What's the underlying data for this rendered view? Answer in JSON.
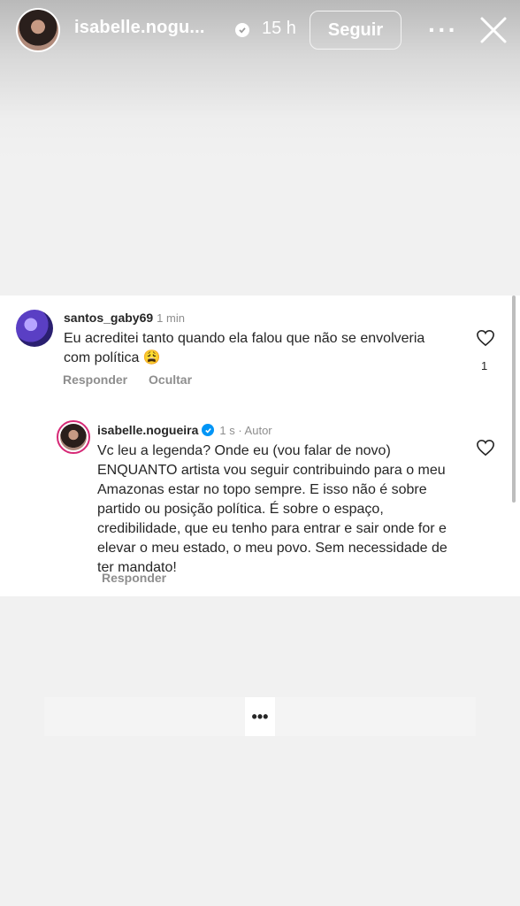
{
  "header": {
    "username": "isabelle.nogu...",
    "time": "15 h",
    "follow_label": "Seguir",
    "more_icon": "more-horizontal-icon",
    "close_icon": "close-icon"
  },
  "comment": {
    "username": "santos_gaby69",
    "time": "1 min",
    "text": "Eu acreditei tanto quando ela falou que não se envolveria com política 😩",
    "reply_label": "Responder",
    "hide_label": "Ocultar",
    "like_count": "1"
  },
  "reply": {
    "username": "isabelle.nogueira",
    "meta": "1 s · Autor",
    "text": "Vc leu a legenda? Onde eu (vou falar de novo) ENQUANTO artista vou seguir contribuindo para o meu Amazonas estar no topo sempre. E isso não é sobre partido ou posição política. É sobre o espaço, credibilidade, que eu tenho para entrar e sair onde for e elevar o meu estado, o meu povo. Sem necessidade de ter mandato!",
    "reply_label": "Responder"
  },
  "footer": {
    "more_label": "•••"
  },
  "colors": {
    "verified_blue": "#0095f6",
    "text_primary": "#262626",
    "text_secondary": "#8e8e8e"
  }
}
